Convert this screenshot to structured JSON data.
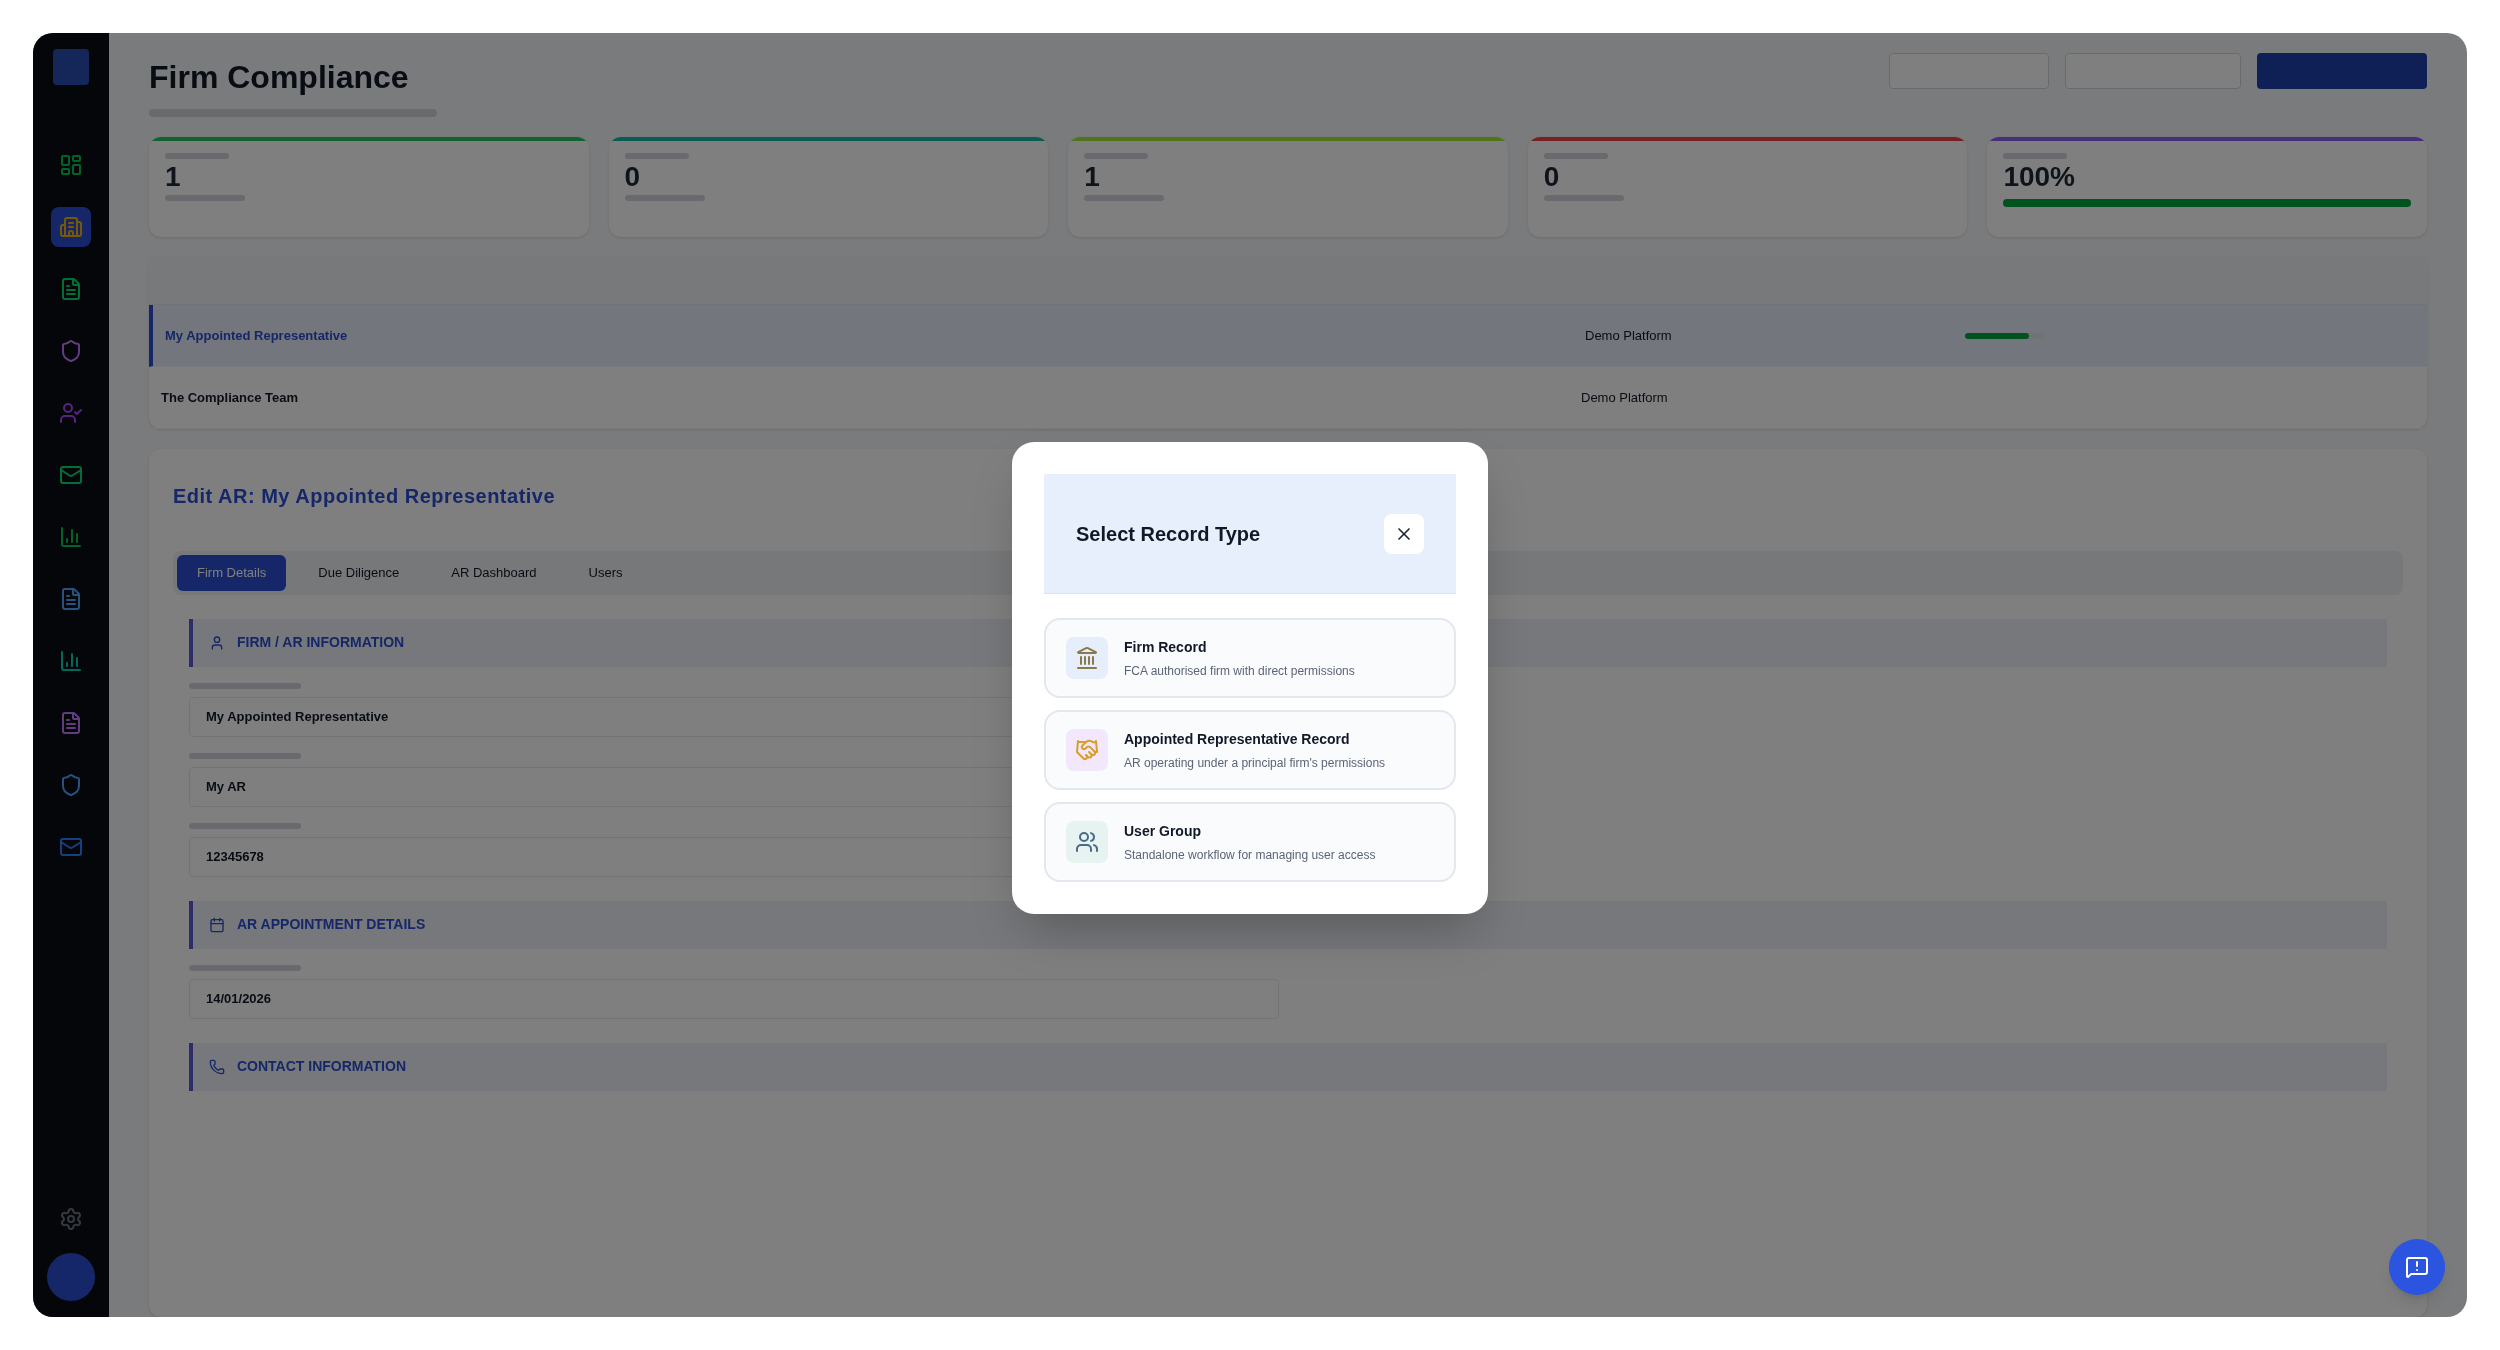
{
  "page": {
    "title": "Firm Compliance"
  },
  "stats": [
    {
      "value": "1",
      "kind": "count",
      "bar": {
        "color": "#11622f"
      }
    },
    {
      "value": "0",
      "kind": "count",
      "bar": {
        "color": "#0a5c53"
      }
    },
    {
      "value": "1",
      "kind": "count",
      "bar": {
        "color": "#51731a"
      }
    },
    {
      "value": "0",
      "kind": "count",
      "bar": {
        "color": "#772222"
      }
    },
    {
      "value": "100%",
      "kind": "progress",
      "bar": {
        "color": "#452e7b"
      },
      "level": 1
    }
  ],
  "table": {
    "rows": [
      {
        "name": "My Appointed Representative",
        "workflow": "Demo Platform",
        "selected": true,
        "level": 0.8
      },
      {
        "name": "The Compliance Team",
        "workflow": "Demo Platform",
        "selected": false
      }
    ]
  },
  "editor": {
    "title": "Edit AR: My Appointed Representative",
    "tabs": [
      {
        "label": "Firm Details",
        "selected": true
      },
      {
        "label": "Due Diligence",
        "selected": false
      },
      {
        "label": "AR Dashboard",
        "selected": false
      },
      {
        "label": "Users",
        "selected": false
      }
    ],
    "sections": [
      {
        "heading": "FIRM / AR INFORMATION",
        "fields": [
          "My Appointed Representative",
          "My AR",
          "12345678"
        ]
      },
      {
        "heading": "AR APPOINTMENT DETAILS",
        "fields": [
          "14/01/2026"
        ]
      },
      {
        "heading": "CONTACT INFORMATION"
      }
    ]
  },
  "modal": {
    "title": "Select Record Type",
    "options": [
      {
        "kind": "firm",
        "title": "Firm Record",
        "description": "FCA authorised firm with direct permissions"
      },
      {
        "kind": "ar",
        "title": "Appointed Representative Record",
        "description": "AR operating under a principal firm's permissions"
      },
      {
        "kind": "group",
        "title": "User Group",
        "description": "Standalone workflow for managing user access"
      }
    ]
  }
}
